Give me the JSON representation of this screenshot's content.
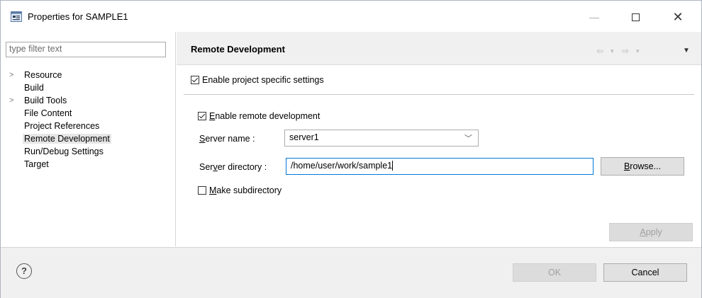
{
  "window": {
    "title": "Properties for SAMPLE1",
    "min_glyph": "—",
    "max_glyph": "☐",
    "close_glyph": "✕",
    "app_icon": "properties-app-icon"
  },
  "left": {
    "filter_placeholder": "type filter text",
    "tree": [
      {
        "label": "Resource",
        "expandable": true
      },
      {
        "label": "Build",
        "expandable": false
      },
      {
        "label": "Build Tools",
        "expandable": true
      },
      {
        "label": "File Content",
        "expandable": false
      },
      {
        "label": "Project References",
        "expandable": false
      },
      {
        "label": "Remote Development",
        "expandable": false,
        "selected": true
      },
      {
        "label": "Run/Debug Settings",
        "expandable": false
      },
      {
        "label": "Target",
        "expandable": false
      }
    ]
  },
  "page": {
    "title": "Remote Development",
    "nav": {
      "back": "⇦",
      "back_dd": "▾",
      "fwd": "⇨",
      "fwd_dd": "▾",
      "menu": "▼"
    },
    "project_specific": {
      "label": "Enable project specific settings",
      "checked": true
    },
    "enable_remote": {
      "mnemonic": "E",
      "label_rest": "nable remote development",
      "checked": true
    },
    "server_name": {
      "mnemonic": "S",
      "label_rest": "erver name :",
      "value": "server1"
    },
    "server_dir": {
      "label_pre": "Ser",
      "mnemonic": "v",
      "label_rest": "er directory :",
      "value": "/home/user/work/sample1"
    },
    "browse": {
      "mnemonic": "B",
      "label_rest": "rowse..."
    },
    "make_subdir": {
      "mnemonic": "M",
      "label_rest": "ake subdirectory",
      "checked": false
    },
    "apply": {
      "mnemonic": "A",
      "label_rest": "pply",
      "enabled": false
    }
  },
  "footer": {
    "help": "?",
    "ok": "OK",
    "cancel": "Cancel"
  }
}
